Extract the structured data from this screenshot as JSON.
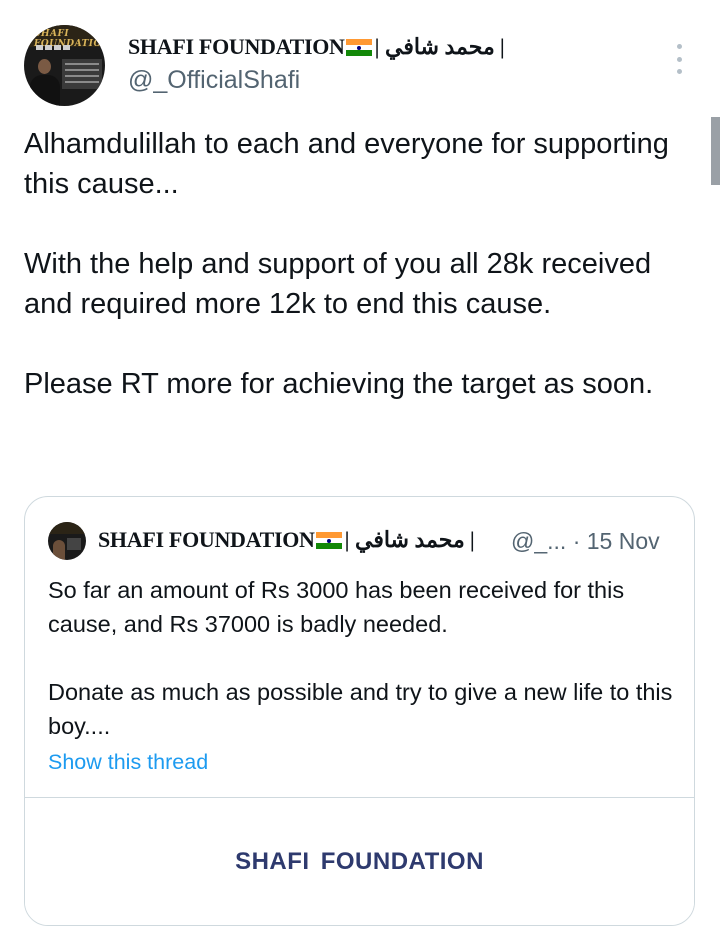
{
  "tweet": {
    "author": {
      "name_prefix": "SHAFI FOUNDATION",
      "name_suffix": "| محمد شافي |",
      "handle": "@_OfficialShafi",
      "avatar_logo_text": "SHAFI FOUNDATION"
    },
    "paragraphs": [
      "Alhamdulillah to each and everyone for supporting this cause...",
      "With the help and support of you all 28k received and required more 12k to end this cause.",
      "Please RT more for achieving the target as soon."
    ],
    "more_icon": "more-vertical-icon"
  },
  "quoted": {
    "name_prefix": "SHAFI FOUNDATION",
    "name_suffix": "| محمد شافي |",
    "handle_date": "@_... · 15 Nov",
    "paragraphs": [
      "So far an amount of Rs 3000 has been received for this cause, and Rs 37000 is badly needed.",
      "Donate as much as possible and try to give a new life to this boy...."
    ],
    "show_thread": "Show this thread",
    "media_title": "SHAFI FOUNDATION"
  },
  "colors": {
    "text": "#0f1419",
    "secondary": "#536471",
    "link": "#1d9bf0",
    "border": "#cfd9de",
    "media_title": "#2e3a6e"
  }
}
